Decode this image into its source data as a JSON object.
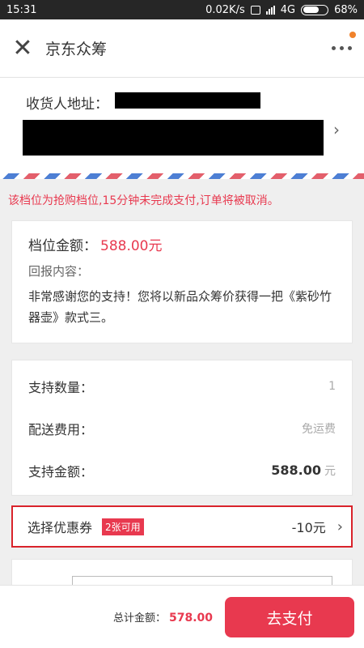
{
  "status_bar": {
    "time": "15:31",
    "speed": "0.02K/s",
    "network": "4G",
    "battery": "68%"
  },
  "nav": {
    "close_icon": "close-icon",
    "title": "京东众筹",
    "more_icon": "more-icon"
  },
  "address": {
    "label": "收货人地址："
  },
  "warning": "该档位为抢购档位,15分钟未完成支付,订单将被取消。",
  "tier": {
    "amount_label": "档位金额：",
    "amount_value": "588.00元",
    "reward_label": "回报内容：",
    "reward_text": "非常感谢您的支持！您将以新品众筹价获得一把《紫砂竹器壶》款式三。"
  },
  "support": {
    "qty_label": "支持数量：",
    "qty_value": "1",
    "shipping_label": "配送费用：",
    "shipping_value": "免运费",
    "amount_label": "支持金额：",
    "amount_value": "588.00",
    "amount_unit": "元"
  },
  "coupon": {
    "label": "选择优惠券",
    "tag": "2张可用",
    "discount": "-10元"
  },
  "footer": {
    "total_label": "总计金额：",
    "total_value": "578.00",
    "pay_button": "去支付"
  },
  "colors": {
    "accent": "#e8394f",
    "highlight_border": "#d9232b"
  }
}
